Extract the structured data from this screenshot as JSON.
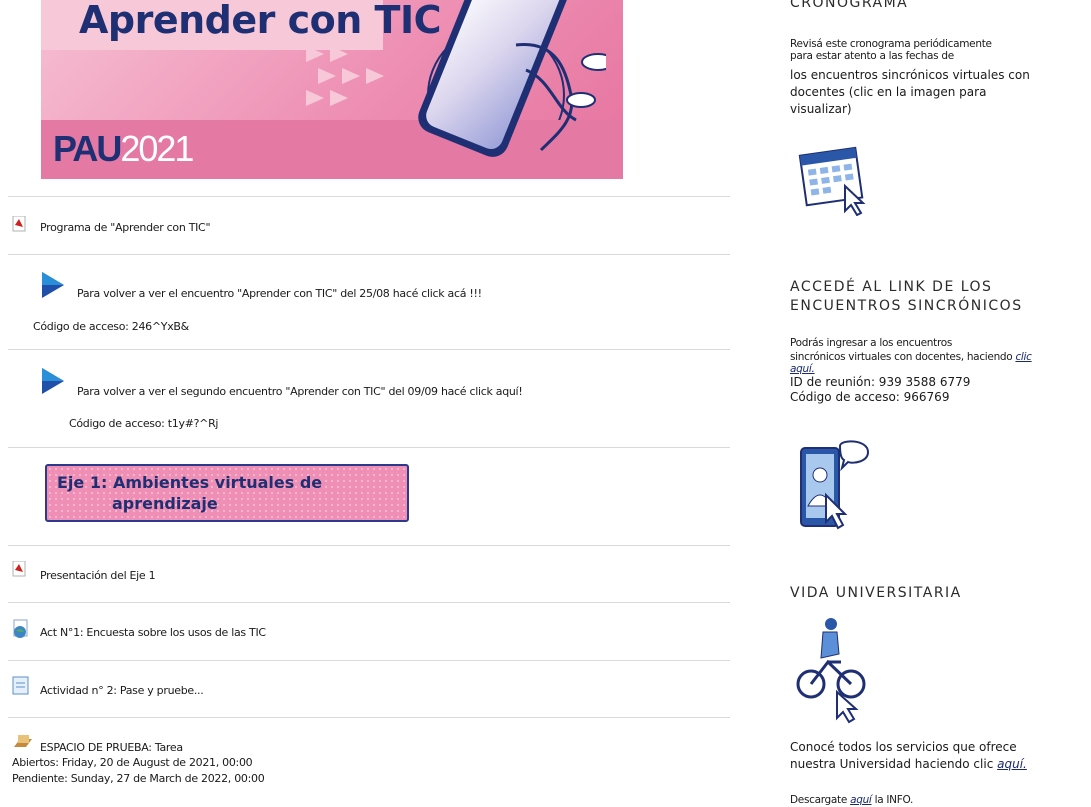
{
  "banner": {
    "title": "Aprender con TIC",
    "pau": "PAU",
    "year": "2021"
  },
  "main": {
    "programa": "Programa de \"Aprender con TIC\"",
    "enc1_text": "Para volver a ver el encuentro \"Aprender con TIC\" del 25/08 hacé click ",
    "enc1_link": "acá",
    "enc1_tail": " !!!",
    "enc1_code": "Código de acceso: 246^YxB&",
    "enc2_text": "Para volver a ver el segundo encuentro \"Aprender con TIC\" del 09/09 hacé click ",
    "enc2_link": "aquí",
    "enc2_tail": "!",
    "enc2_code": "Código de acceso: t1y#?^Rj",
    "eje_line1": "Eje 1: Ambientes virtuales de",
    "eje_line2": "aprendizaje",
    "presentacion": "Presentación del Eje 1",
    "act1": "Act N°1: Encuesta sobre los usos de las TIC",
    "act2": "Actividad n° 2: Pase y pruebe...",
    "espacio": "ESPACIO DE PRUEBA: Tarea",
    "abiertos_label": "Abiertos:",
    "abiertos_value": " Friday, 20 de August de 2021, 00:00",
    "pendiente_label": "Pendiente:",
    "pendiente_value": " Sunday, 27 de March de 2022, 00:00"
  },
  "sidebar": {
    "crono_heading": "CRONOGRAMA",
    "crono_line1": "Revisá este cronograma periódicamente",
    "crono_line2": "para estar atento a las fechas de",
    "crono_line3": "los encuentros sincrónicos virtuales con",
    "crono_line4": "docentes (clic en la imagen para",
    "crono_line5": "visualizar)",
    "link_heading1": "ACCEDÉ AL LINK DE LOS",
    "link_heading2": "ENCUENTROS SINCRÓNICOS",
    "link_line1": "Podrás ingresar a los encuentros",
    "link_line2": "sincrónicos virtuales con docentes, haciendo ",
    "link_clic": "clic",
    "link_aqui": "aquí.",
    "reunion_id": "ID de reunión: 939 3588 6779",
    "reunion_code": "Código de acceso: 966769",
    "vida_heading": "VIDA UNIVERSITARIA",
    "vida_line1": "Conocé todos los servicios que ofrece",
    "vida_line2": "nuestra Universidad haciendo clic ",
    "vida_aqui": "aquí.",
    "descarga_pre": "Descargate ",
    "descarga_aqui": "aquí",
    "descarga_post": " la INFO."
  },
  "colors": {
    "brand_navy": "#1f2f73",
    "banner_pink": "#ee8fb3",
    "pdf_red": "#d0201e"
  }
}
